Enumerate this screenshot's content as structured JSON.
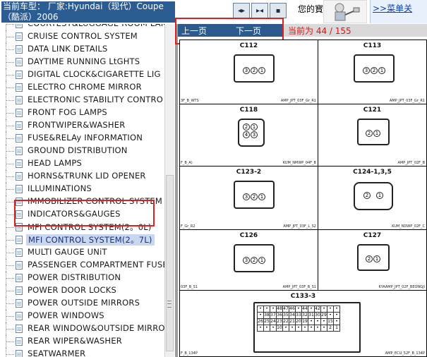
{
  "header": {
    "vehicle_label": "当前车型： 厂家:Hyundai（现代）Coupe（酷派）2006",
    "toolbar_buttons": [
      "first-page-icon",
      "expand-icon",
      "print-icon"
    ],
    "welcome_text": "您的寳",
    "menu_link": ">>菜单关"
  },
  "sidebar": {
    "items": [
      "COURTESY&LUGGAGE ROOM LAM",
      "CRUISE CONTROL SYSTEM",
      "DATA LINK DETAILS",
      "DAYTIME RUNNING LtGHTS",
      "DIGITAL CLOCK&CIGARETTE LIG",
      "ELECTRO CHROME MIRROR",
      "ELECTRONIC STABILITY CONTRO",
      "FRONT FOG LAMPS",
      "FRONTWIPER&WASHER",
      "FUSE&RELAy INFORMATION",
      "GROUND DISTRIBUTION",
      "HEAD LAMPS",
      "HORNS&TRUNK LID OPENER",
      "ILLUMINATIONS",
      "IMMOBILIZER CONTROL SYSTEM",
      "INDICATORS&GAUGES",
      "MFI CONTROL SYSTEM(2。0L)",
      "MFI CONTROL SYSTEM(2。7L)",
      "MULTI GAUGE UNiT",
      "PASSENGER COMPARTMENT FUSE",
      "POWER DISTRIBUTION",
      "POWER DOOR LOCKS",
      "POWER OUTSIDE MIRRORS",
      "POWER WINDOWS",
      "REAR WINDOW&OUTSIDE MIRRO",
      "REAR WIPER&WASHER",
      "SEATWARMER"
    ],
    "selected_index": 17
  },
  "pager": {
    "prev": "上一页",
    "next": "下一页",
    "current": "当前为 44 / 155"
  },
  "connectors": {
    "c112": {
      "name": "C112",
      "code": "AMP_JPT_03F_Gr_R1",
      "left_code": "3F_B_WTS",
      "pins": [
        "3",
        "2",
        "1"
      ]
    },
    "c113": {
      "name": "C113",
      "code": "AMP_JPT_03F_Gr_R1",
      "pins": [
        "3",
        "2",
        "1"
      ]
    },
    "c118": {
      "name": "C118",
      "code": "KUM_NMWP_04F_B",
      "left_code": "F_B_A)",
      "pins": [
        "2",
        "1",
        "4",
        "3"
      ]
    },
    "c121": {
      "name": "C121",
      "code": "AMP_JPT_02F_B",
      "pins": [
        "2",
        "1"
      ]
    },
    "c123_2": {
      "name": "C123-2",
      "code": "AMP_JPT_03F_L_S2",
      "left_code": "F_Gr_R2",
      "pins": [
        "3",
        "2",
        "1"
      ]
    },
    "c124": {
      "name": "C124-1,3,5",
      "code": "KUM_NDWP_02F_C",
      "pins": [
        "2",
        "1"
      ]
    },
    "c126": {
      "name": "C126",
      "code": "AMP_JPT_03F_B_S1",
      "left_code": "03F_B_S1",
      "pins": [
        "3",
        "2",
        "1"
      ]
    },
    "c127": {
      "name": "C127",
      "code": "KYAAMP_JPT_02F_BEONGJI",
      "pins": [
        "2",
        "1"
      ]
    },
    "c133_3": {
      "name": "C133-3",
      "code": "AMP_ECU_52F_B_134P",
      "left_code": "F_B_134P",
      "rows": [
        [
          "•",
          "•",
          "•",
          "48",
          "47",
          "46",
          "•",
          "44",
          "•",
          "42",
          "•",
          "•",
          "•"
        ],
        [
          "•",
          "38",
          "37",
          "36",
          "35",
          "34",
          "33",
          "32",
          "31",
          "30",
          "29",
          "•",
          "•"
        ],
        [
          "26",
          "25",
          "24",
          "23",
          "22",
          "21",
          "20",
          "19",
          "•",
          "•",
          "•",
          "15",
          "•"
        ],
        [
          "•",
          "•",
          "•",
          "10",
          "•",
          "•",
          "•",
          "•",
          "•",
          "•",
          "•",
          "2",
          "1"
        ]
      ]
    }
  }
}
